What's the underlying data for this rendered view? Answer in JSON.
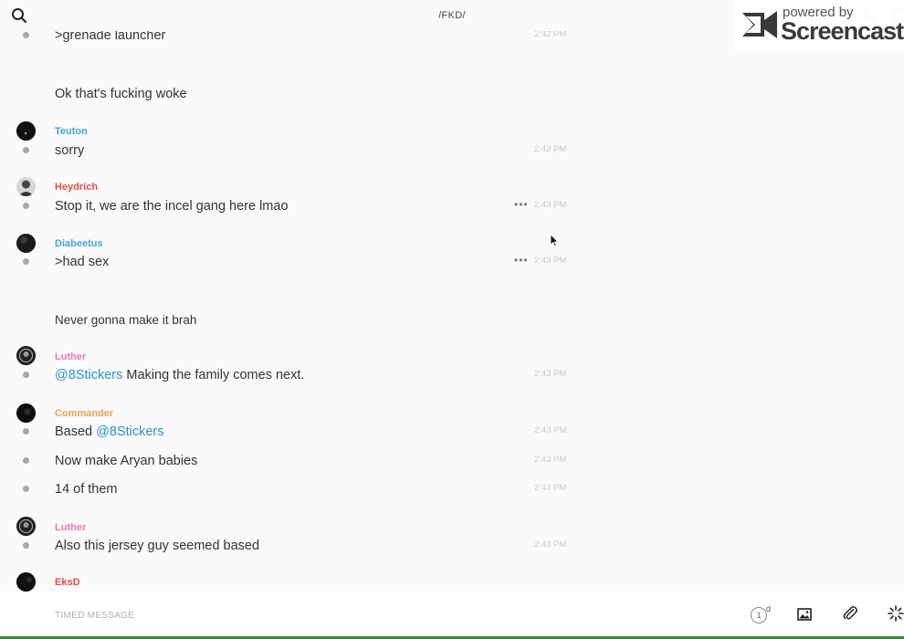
{
  "header": {
    "channel": "/FKD/"
  },
  "watermark": {
    "top": "powered by",
    "brand": "Screencastify"
  },
  "colors": {
    "blue": "#4aa3d8",
    "red": "#e0514f",
    "pink": "#e87ab8",
    "orange": "#f0a24a",
    "mention": "#2f8fd0"
  },
  "messages": [
    {
      "text": ">grenade launcher",
      "time": "2:42 PM"
    },
    {
      "text": "Ok that's fucking woke"
    },
    {
      "user": "Teuton",
      "text": "sorry",
      "time": "2:42 PM"
    },
    {
      "user": "Heydrich",
      "text": "Stop it, we are the incel gang here lmao",
      "time": "2:43 PM",
      "more": "•••"
    },
    {
      "user": "Diabeetus",
      "text": ">had sex",
      "time": "2:43 PM",
      "more": "•••"
    },
    {
      "text": "Never gonna make it brah"
    },
    {
      "user": "Luther",
      "mention": "@8Stickers",
      "text": " Making the family comes next.",
      "time": "2:43 PM"
    },
    {
      "user": "Commander",
      "prefix": "Based ",
      "mention": "@8Stickers",
      "time": "2:43 PM"
    },
    {
      "text": "Now make Aryan babies",
      "time": "2:43 PM"
    },
    {
      "text": "14 of them",
      "time": "2:43 PM"
    },
    {
      "user": "Luther",
      "text": "Also this jersey guy seemed based",
      "time": "2:43 PM"
    },
    {
      "user": "EksD"
    }
  ],
  "composer": {
    "placeholder": "TIMED MESSAGE",
    "timer_value": "1",
    "timer_unit": "d"
  },
  "icons": {
    "search": "search-icon",
    "phone": "phone-icon",
    "info": "info-icon",
    "image": "image-icon",
    "attach": "paperclip-icon",
    "sticker": "sparkle-icon"
  }
}
